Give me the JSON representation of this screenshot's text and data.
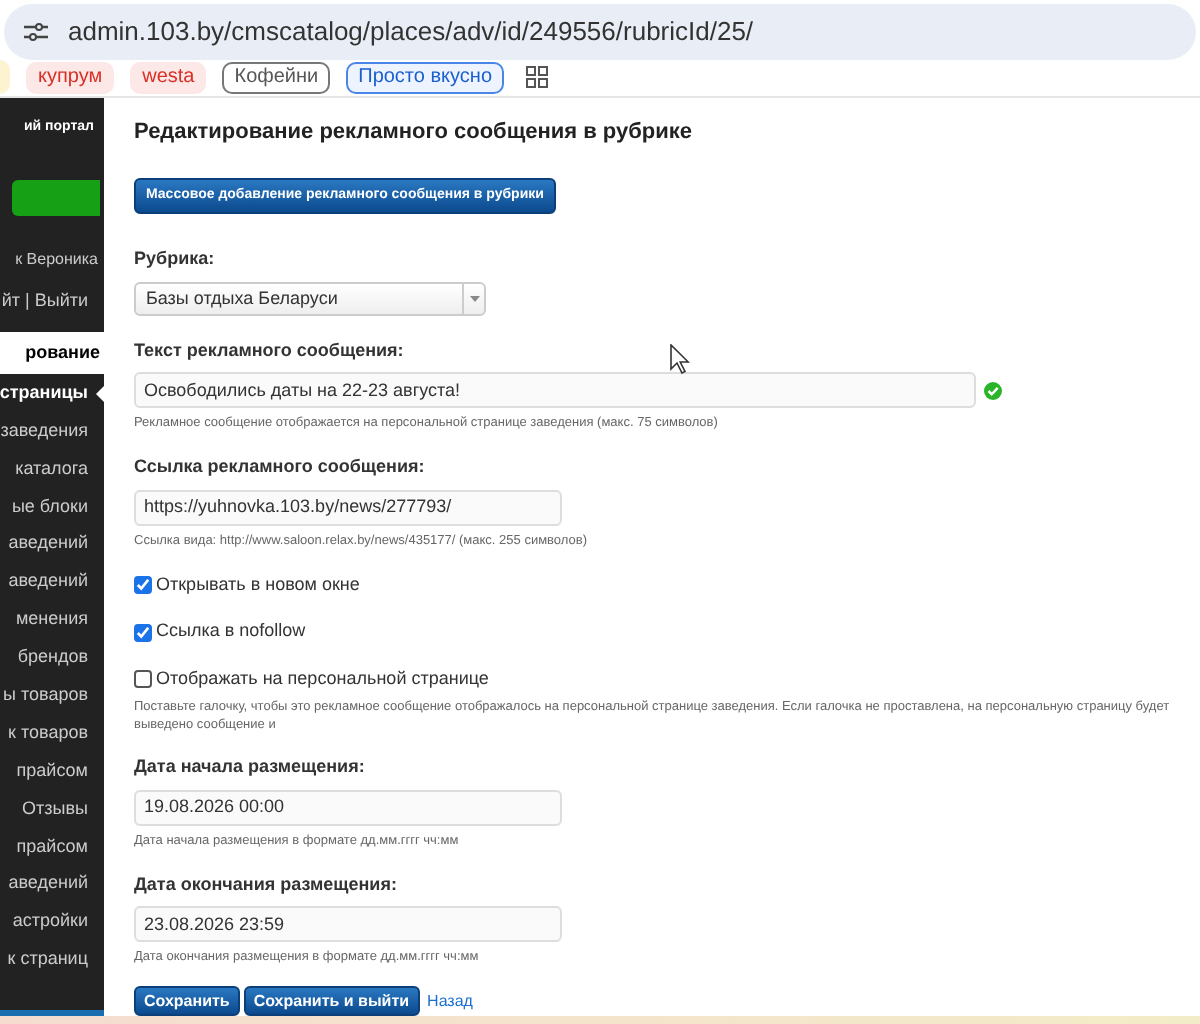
{
  "address_bar": {
    "url": "admin.103.by/cmscatalog/places/adv/id/249556/rubricId/25/"
  },
  "bookmarks": [
    {
      "label": "купрум",
      "kind": "red"
    },
    {
      "label": "westa",
      "kind": "red"
    },
    {
      "label": "Кофейни",
      "kind": "grey"
    },
    {
      "label": "Просто вкусно",
      "kind": "blue"
    }
  ],
  "sidebar": {
    "logo_caption": "ий портал",
    "user": "к Вероника",
    "links": "йт | Выйти",
    "section": "рование",
    "items": [
      {
        "label": "страницы",
        "selected": true
      },
      {
        "label": "заведения",
        "selected": false
      },
      {
        "label": "каталога",
        "selected": false
      },
      {
        "label": "ые блоки",
        "selected": false
      },
      {
        "label": "аведений",
        "selected": false
      },
      {
        "label": "аведений",
        "selected": false
      },
      {
        "label": "менения",
        "selected": false
      },
      {
        "label": "брендов",
        "selected": false
      },
      {
        "label": "ы товаров",
        "selected": false
      },
      {
        "label": "к товаров",
        "selected": false
      },
      {
        "label": "прайсом",
        "selected": false
      },
      {
        "label": "Отзывы",
        "selected": false
      },
      {
        "label": "прайсом",
        "selected": false
      },
      {
        "label": "аведений",
        "selected": false
      },
      {
        "label": "астройки",
        "selected": false
      },
      {
        "label": "к страниц",
        "selected": false
      }
    ]
  },
  "page": {
    "title": "Редактирование рекламного сообщения в рубрике",
    "bulk_button": "Массовое добавление рекламного сообщения в рубрики",
    "fields": [
      {
        "kind": "select",
        "label": "Рубрика:",
        "value": "Базы отдыха Беларуси"
      },
      {
        "kind": "text",
        "label": "Текст рекламного сообщения:",
        "value": "Освободились даты на 22-23 августа!",
        "valid": true,
        "hint": "Рекламное сообщение отображается на персональной странице заведения (макс. 75 символов)"
      },
      {
        "kind": "short",
        "label": "Ссылка рекламного сообщения:",
        "value": "https://yuhnovka.103.by/news/277793/",
        "hint": "Ссылка вида: http://www.saloon.relax.by/news/435177/ (макс. 255 символов)"
      },
      {
        "kind": "checkbox",
        "label": "Открывать в новом окне",
        "checked": true
      },
      {
        "kind": "checkbox",
        "label": "Ссылка в nofollow",
        "checked": true
      },
      {
        "kind": "checkbox",
        "label": "Отображать на персональной странице",
        "checked": false,
        "hint": "Поставьте галочку, чтобы это рекламное сообщение отображалось на персональной странице заведения. Если галочка не проставлена, на персональную страницу будет выведено сообщение и"
      },
      {
        "kind": "short",
        "label": "Дата начала размещения:",
        "value": "19.08.2026 00:00",
        "hint": "Дата начала размещения в формате дд.мм.гггг чч:мм"
      },
      {
        "kind": "short",
        "label": "Дата окончания размещения:",
        "value": "23.08.2026 23:59",
        "hint": "Дата окончания размещения в формате дд.мм.гггг чч:мм"
      }
    ],
    "buttons": [
      "Сохранить",
      "Сохранить и выйти"
    ],
    "back_link": "Назад"
  }
}
